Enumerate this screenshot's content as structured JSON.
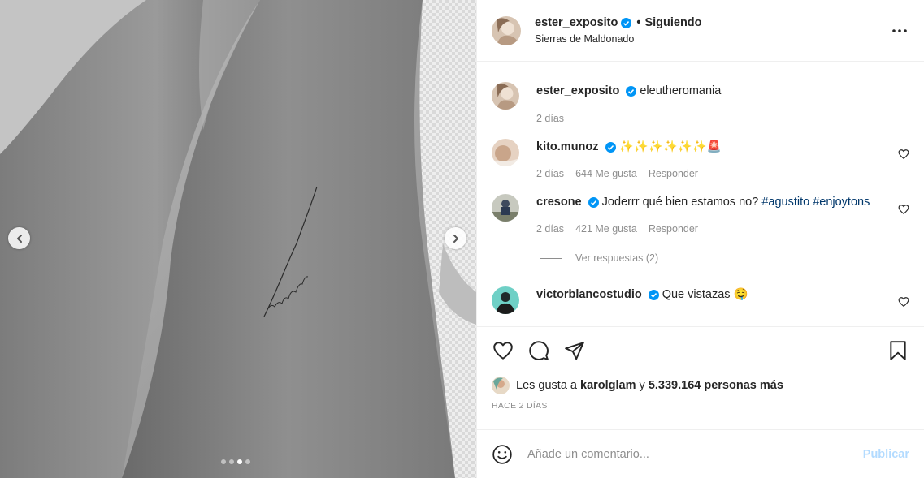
{
  "header": {
    "username": "ester_exposito",
    "separator": "•",
    "follow_status": "Siguiendo",
    "location": "Sierras de Maldonado"
  },
  "carousel": {
    "slide_count": 4,
    "active_index": 2
  },
  "caption": {
    "username": "ester_exposito",
    "text": "eleutheromania",
    "time": "2 días"
  },
  "comments": [
    {
      "username": "kito.munoz",
      "text": "✨✨✨✨✨✨🚨",
      "time": "2 días",
      "likes": "644 Me gusta",
      "reply": "Responder"
    },
    {
      "username": "cresone",
      "text": "Joderrr qué bien estamos no?",
      "hashtags": "#agustito #enjoytons",
      "time": "2 días",
      "likes": "421 Me gusta",
      "reply": "Responder",
      "view_replies": "Ver respuestas (2)"
    },
    {
      "username": "victorblancostudio",
      "text": "Que vistazas 🤤"
    }
  ],
  "likes": {
    "prefix": "Les gusta a",
    "user": "karolglam",
    "middle": "y",
    "count": "5.339.164 personas más"
  },
  "timestamp": "HACE 2 DÍAS",
  "add_comment": {
    "placeholder": "Añade un comentario...",
    "publish": "Publicar"
  },
  "colors": {
    "verified": "#0095f6",
    "hashtag": "#00376b",
    "publish_disabled": "#b3dbff",
    "muted": "#8e8e8e"
  },
  "icons": [
    "chevron-left-icon",
    "chevron-right-icon",
    "more-icon",
    "verified-icon",
    "heart-icon",
    "comment-icon",
    "share-icon",
    "bookmark-icon",
    "emoji-icon"
  ]
}
